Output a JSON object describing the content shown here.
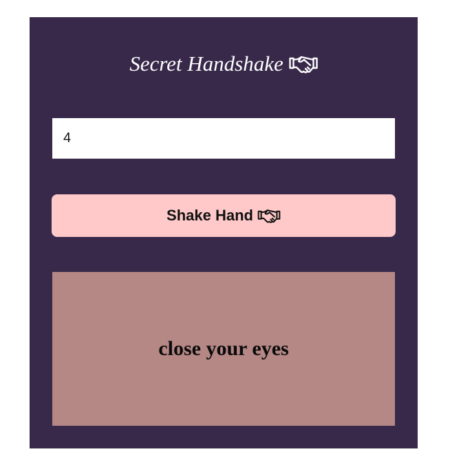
{
  "app": {
    "title": "Secret Handshake",
    "title_icon": "handshake-icon"
  },
  "form": {
    "number_value": "4"
  },
  "button": {
    "label": "Shake Hand",
    "icon": "handshake-icon"
  },
  "result": {
    "text": "close your eyes"
  },
  "colors": {
    "panel_background": "#38294a",
    "title_text": "#ffffff",
    "button_background": "#ffc9c9",
    "result_background": "#b58785"
  }
}
